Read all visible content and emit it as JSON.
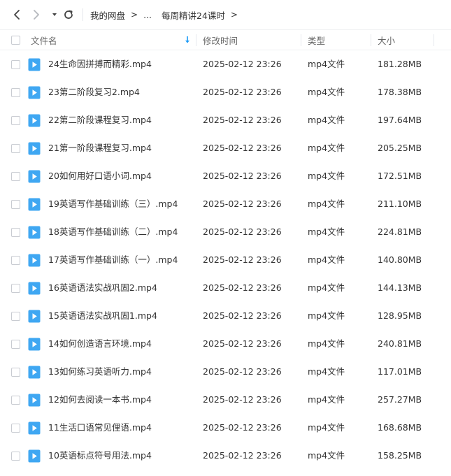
{
  "breadcrumb": {
    "root": "我的网盘",
    "ellipsis": "...",
    "current": "每周精讲24课时"
  },
  "columns": {
    "name": "文件名",
    "mtime": "修改时间",
    "type": "类型",
    "size": "大小"
  },
  "colors": {
    "accent": "#1b9af7",
    "file_icon": "#3fa7f2"
  },
  "files": [
    {
      "name": "24生命因拼搏而精彩.mp4",
      "mtime": "2025-02-12 23:26",
      "type": "mp4文件",
      "size": "181.28MB"
    },
    {
      "name": "23第二阶段复习2.mp4",
      "mtime": "2025-02-12 23:26",
      "type": "mp4文件",
      "size": "178.38MB"
    },
    {
      "name": "22第二阶段课程复习.mp4",
      "mtime": "2025-02-12 23:26",
      "type": "mp4文件",
      "size": "197.64MB"
    },
    {
      "name": "21第一阶段课程复习.mp4",
      "mtime": "2025-02-12 23:26",
      "type": "mp4文件",
      "size": "205.25MB"
    },
    {
      "name": "20如何用好口语小词.mp4",
      "mtime": "2025-02-12 23:26",
      "type": "mp4文件",
      "size": "172.51MB"
    },
    {
      "name": "19英语写作基础训练（三）.mp4",
      "mtime": "2025-02-12 23:26",
      "type": "mp4文件",
      "size": "211.10MB"
    },
    {
      "name": "18英语写作基础训练（二）.mp4",
      "mtime": "2025-02-12 23:26",
      "type": "mp4文件",
      "size": "224.81MB"
    },
    {
      "name": "17英语写作基础训练（一）.mp4",
      "mtime": "2025-02-12 23:26",
      "type": "mp4文件",
      "size": "140.80MB"
    },
    {
      "name": "16英语语法实战巩固2.mp4",
      "mtime": "2025-02-12 23:26",
      "type": "mp4文件",
      "size": "144.13MB"
    },
    {
      "name": "15英语语法实战巩固1.mp4",
      "mtime": "2025-02-12 23:26",
      "type": "mp4文件",
      "size": "128.95MB"
    },
    {
      "name": "14如何创造语言环境.mp4",
      "mtime": "2025-02-12 23:26",
      "type": "mp4文件",
      "size": "240.81MB"
    },
    {
      "name": "13如何练习英语听力.mp4",
      "mtime": "2025-02-12 23:26",
      "type": "mp4文件",
      "size": "117.01MB"
    },
    {
      "name": "12如何去阅读一本书.mp4",
      "mtime": "2025-02-12 23:26",
      "type": "mp4文件",
      "size": "257.27MB"
    },
    {
      "name": "11生活口语常见俚语.mp4",
      "mtime": "2025-02-12 23:26",
      "type": "mp4文件",
      "size": "168.68MB"
    },
    {
      "name": "10英语标点符号用法.mp4",
      "mtime": "2025-02-12 23:26",
      "type": "mp4文件",
      "size": "158.25MB"
    }
  ]
}
